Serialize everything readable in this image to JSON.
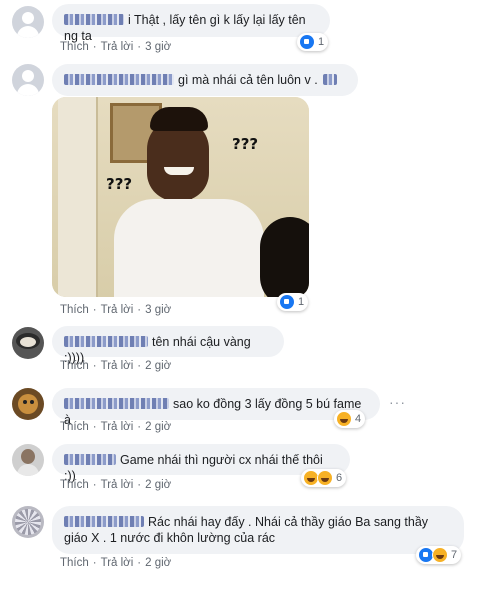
{
  "comments": [
    {
      "text": "i Thật , lấy tên gì k lấy lại lấy tên ng ta",
      "reactions": "1",
      "time": "3 giờ"
    },
    {
      "text": "gì mà nhái cả tên luôn v .",
      "reactions": "1",
      "time": "3 giờ",
      "meme_text_1": "???",
      "meme_text_2": "???"
    },
    {
      "text": "tên nhái cậu vàng :))))",
      "time": "2 giờ"
    },
    {
      "text": "sao ko đồng 3 lấy đồng 5 bú fame à",
      "reactions": "4",
      "time": "2 giờ"
    },
    {
      "text": "Game nhái thì người cx nhái thế thôi :))",
      "reactions": "6",
      "time": "2 giờ"
    },
    {
      "text_line1": "Rác nhái hay đấy . Nhái cả thầy giáo Ba sang thầy",
      "text_line2": "giáo X . 1 nước đi khôn lường của rác",
      "reactions": "7",
      "time": "2 giờ"
    }
  ],
  "actions": {
    "like": "Thích",
    "reply": "Trả lời",
    "sep": "·"
  },
  "more": "···"
}
